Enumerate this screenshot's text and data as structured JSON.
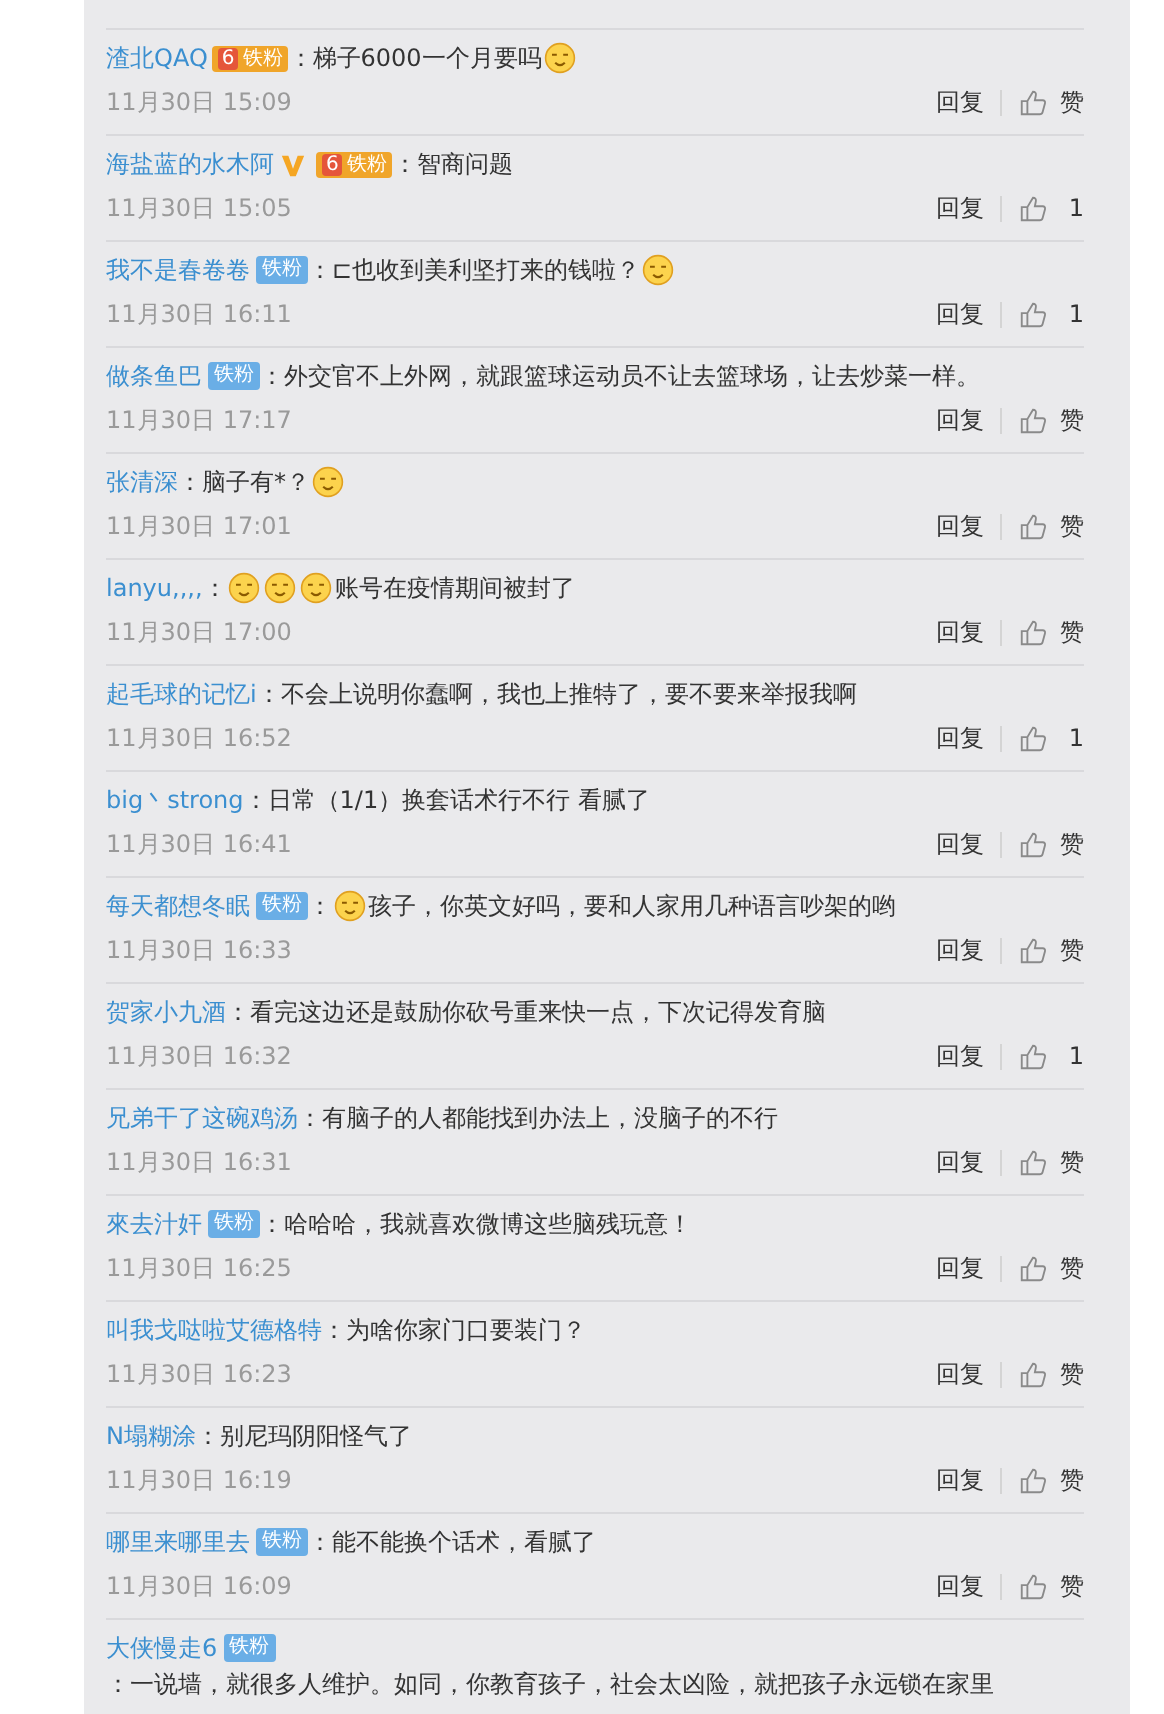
{
  "comments": [
    {
      "user": "渣北QAQ",
      "badge": {
        "kind": "crown",
        "level": "6",
        "label": "铁粉"
      },
      "parts": [
        {
          "kind": "text",
          "text": "：梯子6000一个月要吗"
        },
        {
          "kind": "emoji"
        }
      ],
      "time": "11月30日 15:09",
      "reply": "回复",
      "likes": "赞"
    },
    {
      "user": "海盐蓝的水木阿",
      "verified": true,
      "badge": {
        "kind": "crown",
        "level": "6",
        "label": "铁粉"
      },
      "parts": [
        {
          "kind": "text",
          "text": "：智商问题"
        }
      ],
      "time": "11月30日 15:05",
      "reply": "回复",
      "likes": "1"
    },
    {
      "user": "我不是春卷卷",
      "badge": {
        "kind": "plain",
        "label": "铁粉"
      },
      "parts": [
        {
          "kind": "text",
          "text": "：⊏也收到美利坚打来的钱啦？"
        },
        {
          "kind": "emoji"
        }
      ],
      "time": "11月30日 16:11",
      "reply": "回复",
      "likes": "1"
    },
    {
      "user": "做条鱼巴",
      "badge": {
        "kind": "plain",
        "label": "铁粉"
      },
      "parts": [
        {
          "kind": "text",
          "text": "：外交官不上外网，就跟篮球运动员不让去篮球场，让去炒菜一样。"
        }
      ],
      "time": "11月30日 17:17",
      "reply": "回复",
      "likes": "赞"
    },
    {
      "user": "张清深",
      "parts": [
        {
          "kind": "text",
          "text": "：脑子有*？"
        },
        {
          "kind": "emoji"
        }
      ],
      "time": "11月30日 17:01",
      "reply": "回复",
      "likes": "赞"
    },
    {
      "user": "lanyu,,,,",
      "parts": [
        {
          "kind": "text",
          "text": "："
        },
        {
          "kind": "emoji"
        },
        {
          "kind": "emoji"
        },
        {
          "kind": "emoji"
        },
        {
          "kind": "text",
          "text": "账号在疫情期间被封了"
        }
      ],
      "time": "11月30日 17:00",
      "reply": "回复",
      "likes": "赞"
    },
    {
      "user": "起毛球的记忆i",
      "parts": [
        {
          "kind": "text",
          "text": "：不会上说明你蠢啊，我也上推特了，要不要来举报我啊"
        }
      ],
      "time": "11月30日 16:52",
      "reply": "回复",
      "likes": "1"
    },
    {
      "user": "big丶strong",
      "parts": [
        {
          "kind": "text",
          "text": "：日常（1/1）换套话术行不行 看腻了"
        }
      ],
      "time": "11月30日 16:41",
      "reply": "回复",
      "likes": "赞"
    },
    {
      "user": "每天都想冬眠",
      "badge": {
        "kind": "plain",
        "label": "铁粉"
      },
      "parts": [
        {
          "kind": "text",
          "text": "："
        },
        {
          "kind": "emoji"
        },
        {
          "kind": "text",
          "text": "孩子，你英文好吗，要和人家用几种语言吵架的哟"
        }
      ],
      "time": "11月30日 16:33",
      "reply": "回复",
      "likes": "赞"
    },
    {
      "user": "贺家小九酒",
      "parts": [
        {
          "kind": "text",
          "text": "：看完这边还是鼓励你砍号重来快一点，下次记得发育脑"
        }
      ],
      "time": "11月30日 16:32",
      "reply": "回复",
      "likes": "1"
    },
    {
      "user": "兄弟干了这碗鸡汤",
      "parts": [
        {
          "kind": "text",
          "text": "：有脑子的人都能找到办法上，没脑子的不行"
        }
      ],
      "time": "11月30日 16:31",
      "reply": "回复",
      "likes": "赞"
    },
    {
      "user": "來去汁奸",
      "badge": {
        "kind": "plain",
        "label": "铁粉"
      },
      "parts": [
        {
          "kind": "text",
          "text": "：哈哈哈，我就喜欢微博这些脑残玩意！"
        }
      ],
      "time": "11月30日 16:25",
      "reply": "回复",
      "likes": "赞"
    },
    {
      "user": "叫我戈哒啦艾德格特",
      "parts": [
        {
          "kind": "text",
          "text": "：为啥你家门口要装门？"
        }
      ],
      "time": "11月30日 16:23",
      "reply": "回复",
      "likes": "赞"
    },
    {
      "user": "N塌糊涂",
      "parts": [
        {
          "kind": "text",
          "text": "：别尼玛阴阳怪气了"
        }
      ],
      "time": "11月30日 16:19",
      "reply": "回复",
      "likes": "赞"
    },
    {
      "user": "哪里来哪里去",
      "badge": {
        "kind": "plain",
        "label": "铁粉"
      },
      "parts": [
        {
          "kind": "text",
          "text": "：能不能换个话术，看腻了"
        }
      ],
      "time": "11月30日 16:09",
      "reply": "回复",
      "likes": "赞"
    },
    {
      "user": "大侠慢走6",
      "badge": {
        "kind": "plain",
        "label": "铁粉"
      },
      "parts": [
        {
          "kind": "text",
          "text": "：一说墙，就很多人维护。如同，你教育孩子，社会太凶险，就把孩子永远锁在家里"
        }
      ]
    }
  ]
}
